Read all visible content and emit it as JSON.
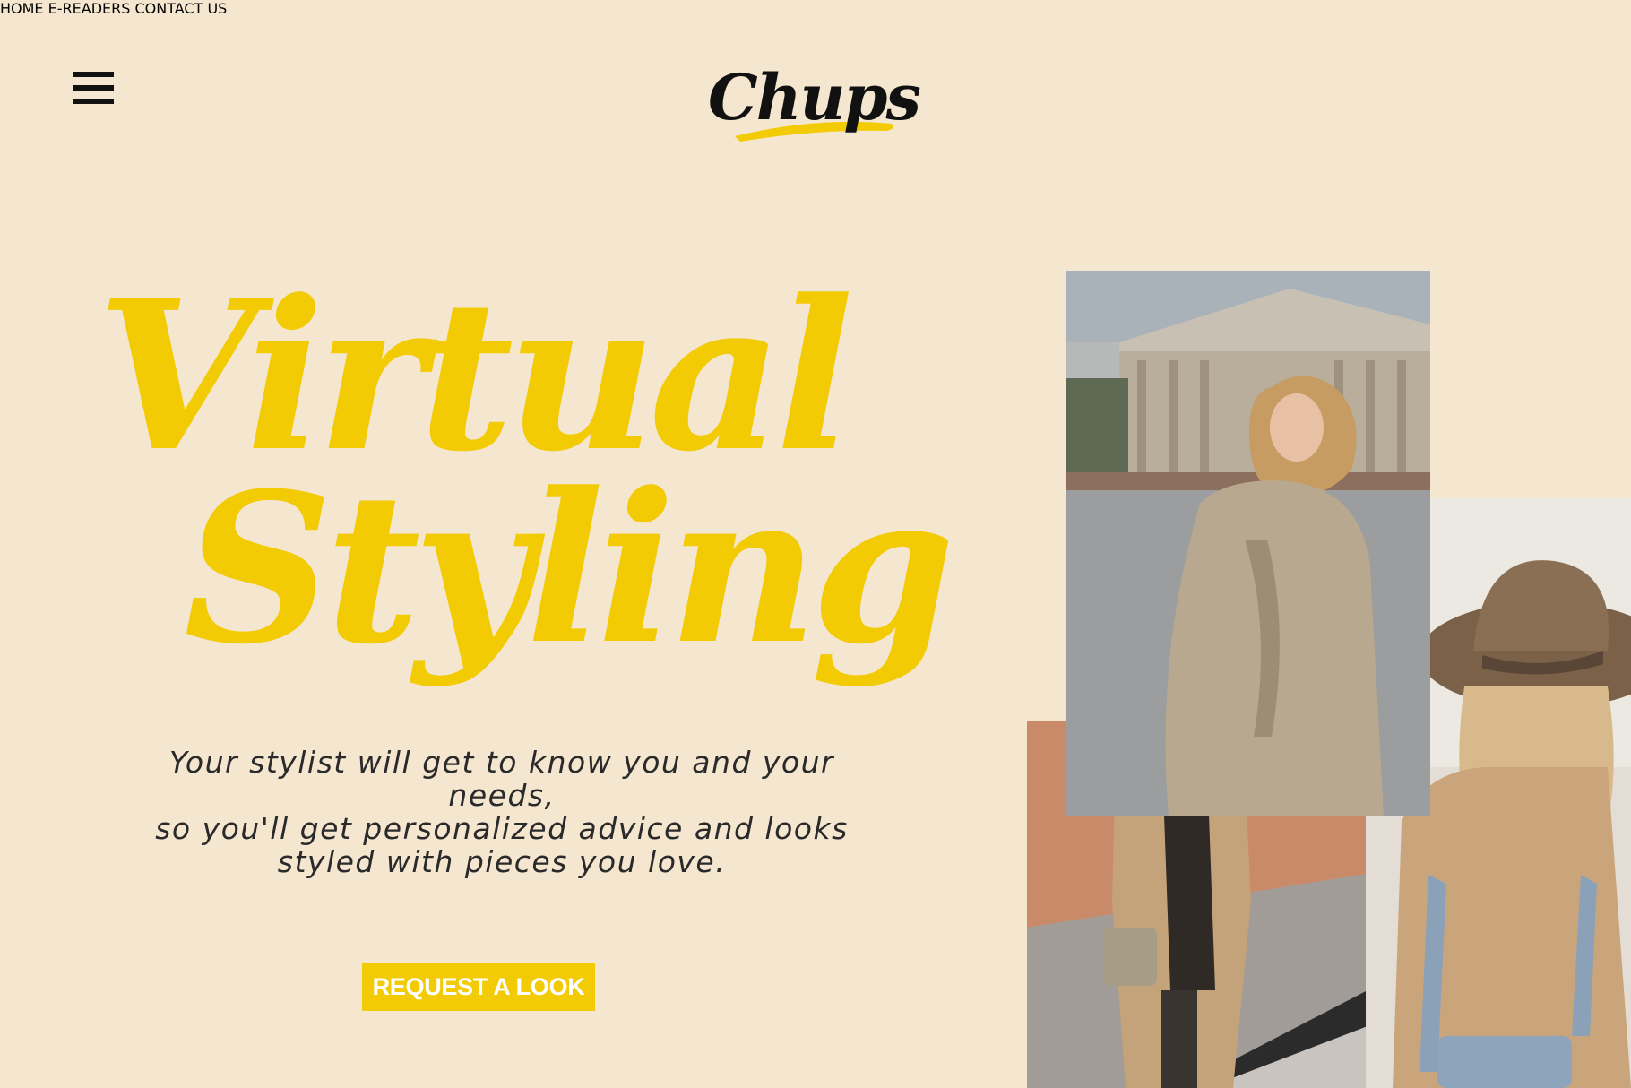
{
  "header": {
    "logo_text": "Chups",
    "nav": [
      {
        "label": "HOME"
      },
      {
        "label": "E-READERS"
      },
      {
        "label": "CONTACT US"
      }
    ]
  },
  "hero": {
    "headline_line1": "Virtual",
    "headline_line2": "Styling",
    "subtitle_lines": [
      "Your stylist will get to know you and your needs,",
      "so you'll get personalized advice and looks",
      "styled with pieces you love."
    ],
    "cta_label": "REQUEST A LOOK"
  },
  "colors": {
    "background": "#f5e6d0",
    "accent": "#f2cb05",
    "text": "#111111"
  },
  "icons": {
    "menu": "hamburger-menu-icon"
  }
}
